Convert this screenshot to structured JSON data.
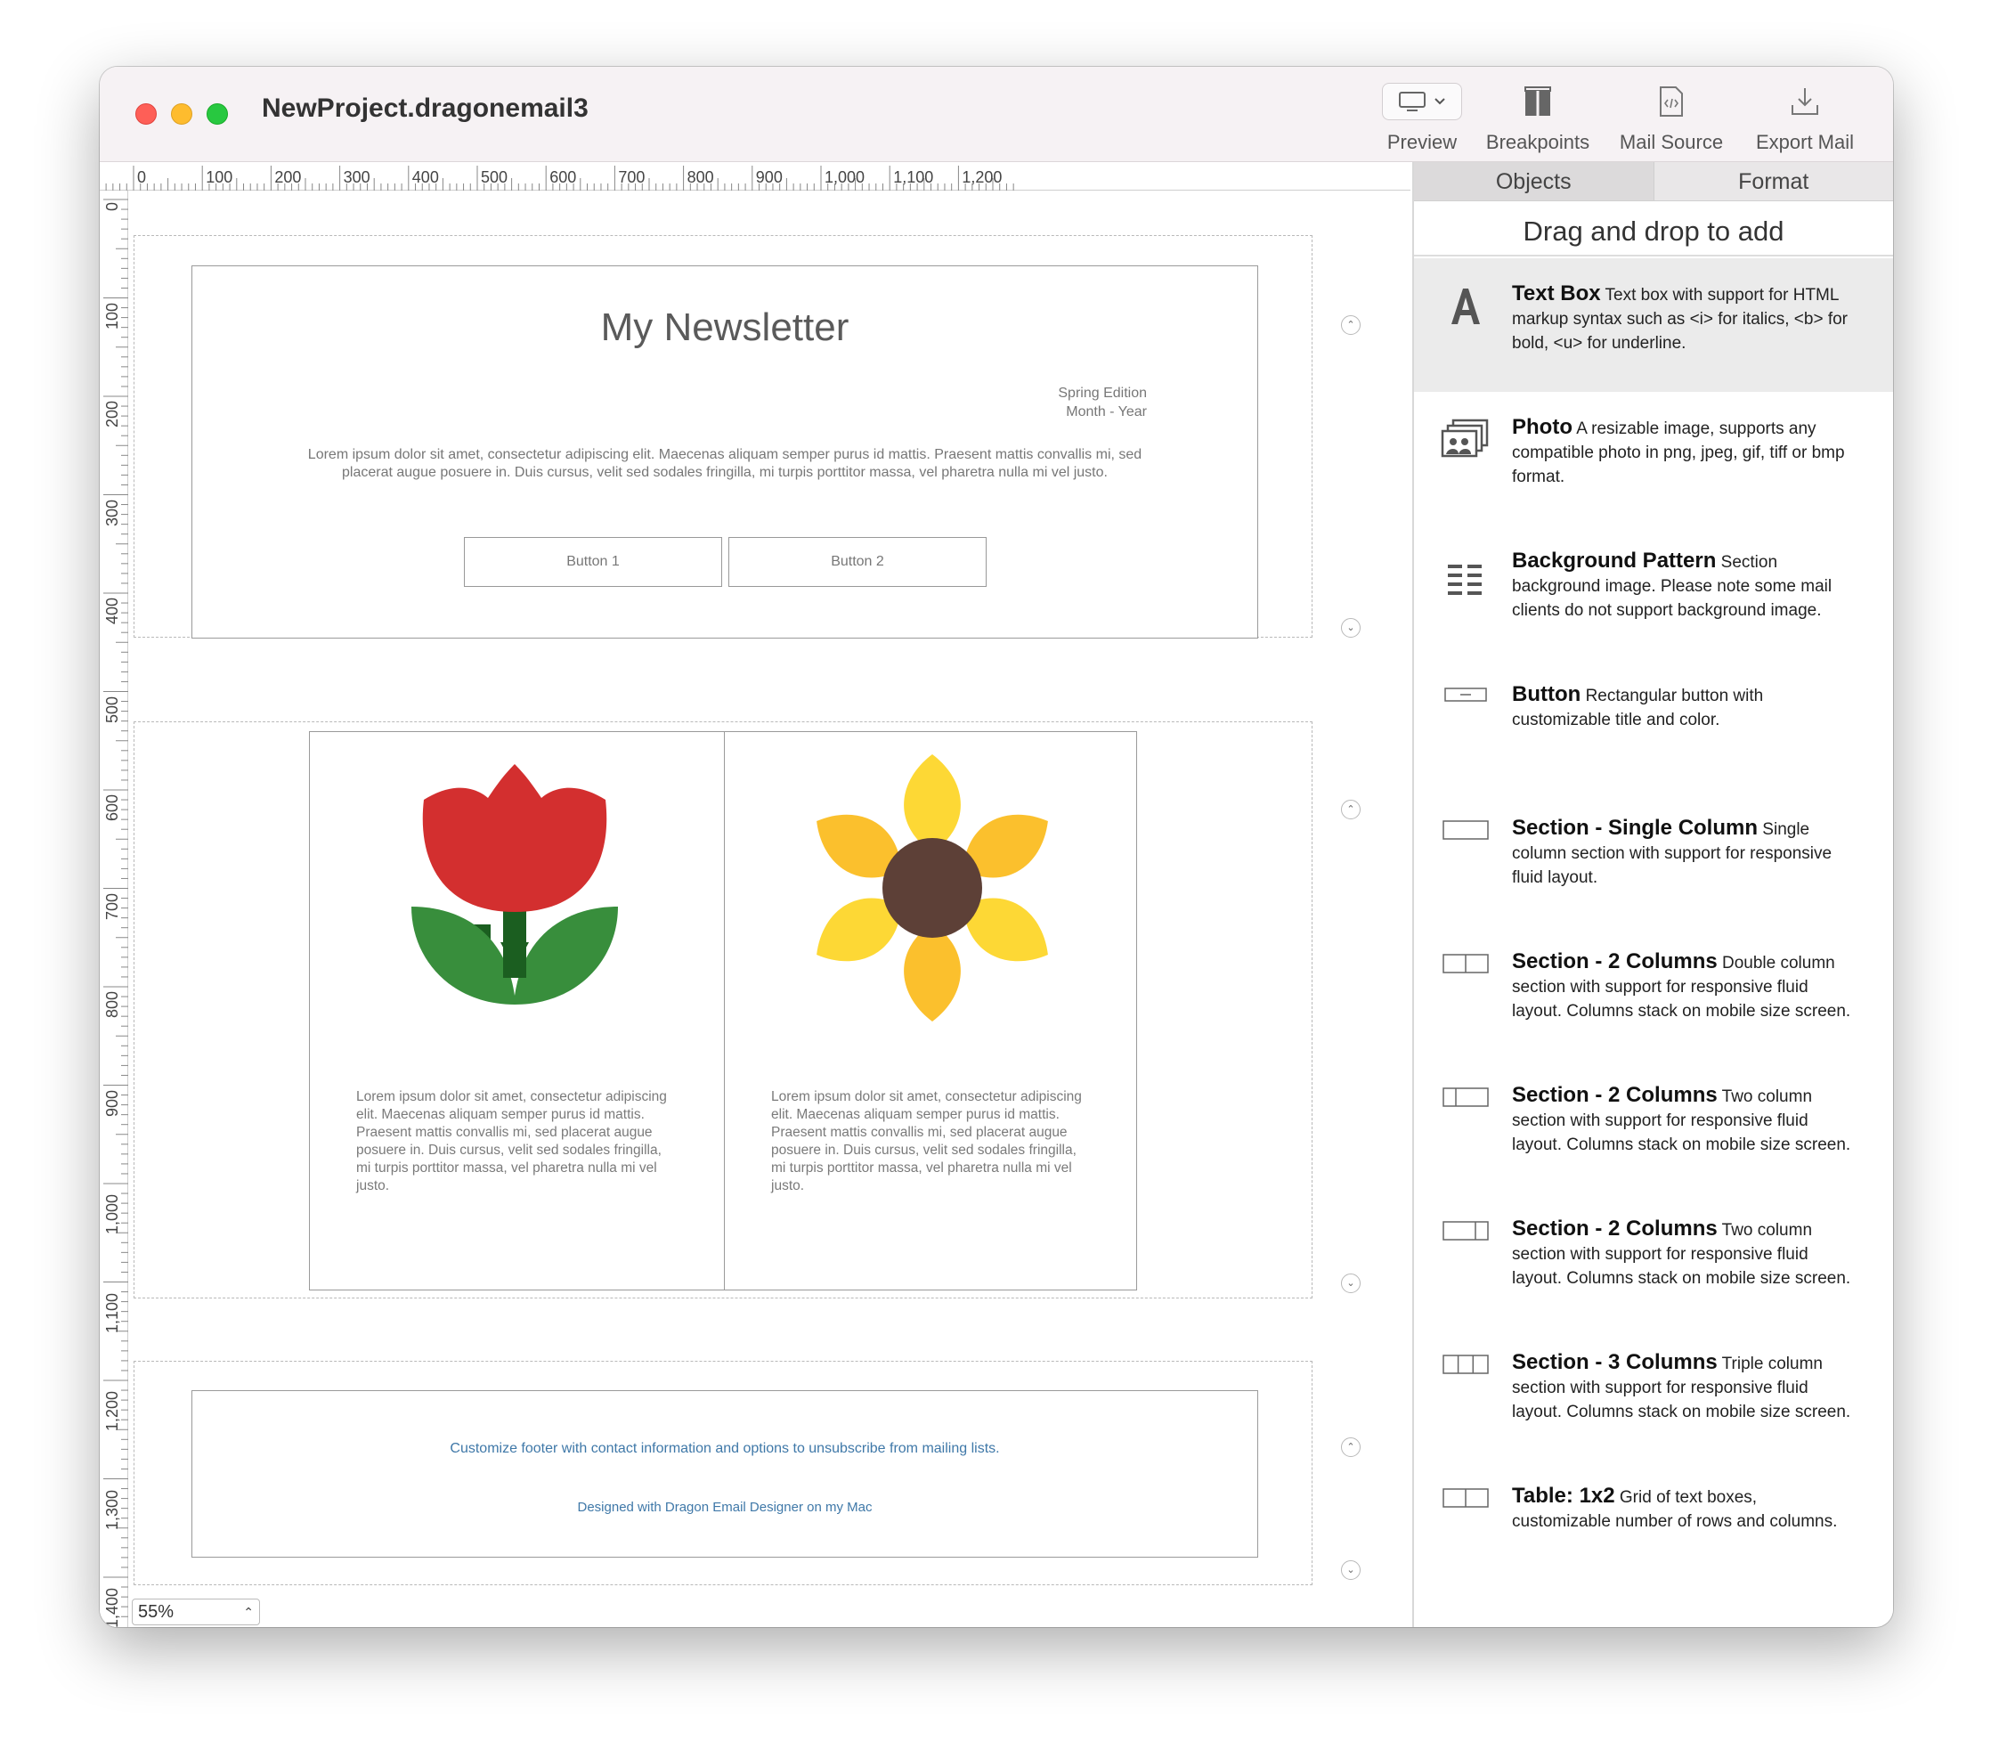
{
  "window": {
    "title": "NewProject.dragonemail3"
  },
  "toolbar": {
    "preview_label": "Preview",
    "breakpoints_label": "Breakpoints",
    "mail_source_label": "Mail Source",
    "export_mail_label": "Export Mail"
  },
  "ruler": {
    "h_ticks": [
      "0",
      "100",
      "200",
      "300",
      "400",
      "500",
      "600",
      "700",
      "800",
      "900",
      "1,000",
      "1,100",
      "1,200"
    ],
    "v_ticks": [
      "0",
      "100",
      "200",
      "300",
      "400",
      "500",
      "600",
      "700",
      "800",
      "900",
      "1,000",
      "1,100",
      "1,200",
      "1,300",
      "1,400"
    ]
  },
  "header_section": {
    "title": "My Newsletter",
    "edition_line1": "Spring Edition",
    "edition_line2": "Month - Year",
    "body": "Lorem ipsum dolor sit amet, consectetur adipiscing elit. Maecenas aliquam semper purus id mattis. Praesent mattis convallis mi, sed placerat augue posuere in. Duis cursus, velit sed sodales fringilla, mi turpis porttitor massa, vel pharetra nulla mi vel justo.",
    "button1": "Button 1",
    "button2": "Button 2"
  },
  "columns_section": {
    "left_text": "Lorem ipsum dolor sit amet, consectetur adipiscing elit. Maecenas aliquam semper purus id mattis. Praesent mattis convallis mi, sed placerat augue posuere in. Duis cursus, velit sed sodales fringilla, mi turpis porttitor massa, vel pharetra nulla mi vel justo.",
    "right_text": "Lorem ipsum dolor sit amet, consectetur adipiscing elit. Maecenas aliquam semper purus id mattis. Praesent mattis convallis mi, sed placerat augue posuere in. Duis cursus, velit sed sodales fringilla, mi turpis porttitor massa, vel pharetra nulla mi vel justo."
  },
  "footer_section": {
    "line1": "Customize footer  with contact information and options to unsubscribe from mailing lists.",
    "line2": "Designed with Dragon Email Designer on my Mac"
  },
  "zoom": {
    "value": "55%"
  },
  "sidebar": {
    "tabs": [
      "Objects",
      "Format"
    ],
    "heading": "Drag and drop to add",
    "items": [
      {
        "name": "Text Box",
        "desc": "Text box with support for HTML markup syntax such as <i> for italics, <b> for bold, <u> for underline.",
        "icon": "text-box-icon"
      },
      {
        "name": "Photo",
        "desc": "A resizable image, supports any compatible photo in png, jpeg, gif, tiff or bmp format.",
        "icon": "photo-icon"
      },
      {
        "name": "Background Pattern",
        "desc": "Section background image.  Please note some mail clients do not support background image.",
        "icon": "background-pattern-icon"
      },
      {
        "name": "Button",
        "desc": "Rectangular button with customizable title and color.",
        "icon": "button-icon"
      },
      {
        "name": "Section - Single Column",
        "desc": "Single column section with support for responsive fluid layout.",
        "icon": "single-column-icon"
      },
      {
        "name": "Section - 2 Columns",
        "desc": "Double column section with support for responsive fluid layout.  Columns stack on mobile size screen.",
        "icon": "two-columns-icon"
      },
      {
        "name": "Section - 2 Columns",
        "desc": "Two column section with support for responsive fluid layout.  Columns stack on mobile size screen.",
        "icon": "two-columns-left-narrow-icon"
      },
      {
        "name": "Section - 2 Columns",
        "desc": "Two column section with support for responsive fluid layout.  Columns stack on mobile size screen.",
        "icon": "two-columns-right-narrow-icon"
      },
      {
        "name": "Section - 3 Columns",
        "desc": "Triple column section with support for responsive fluid layout. Columns stack on mobile size screen.",
        "icon": "three-columns-icon"
      },
      {
        "name": "Table: 1x2",
        "desc": "Grid of text boxes, customizable number of rows and columns.",
        "icon": "table-icon"
      }
    ]
  },
  "colors": {
    "tulip_red": "#d32f2f",
    "leaf_green": "#388e3c",
    "stem_green": "#1b5e20",
    "petal_yellow": "#fdd835",
    "petal_yellow_dark": "#fbc02d",
    "flower_center": "#5d4037",
    "link_blue": "#3f78a8"
  }
}
